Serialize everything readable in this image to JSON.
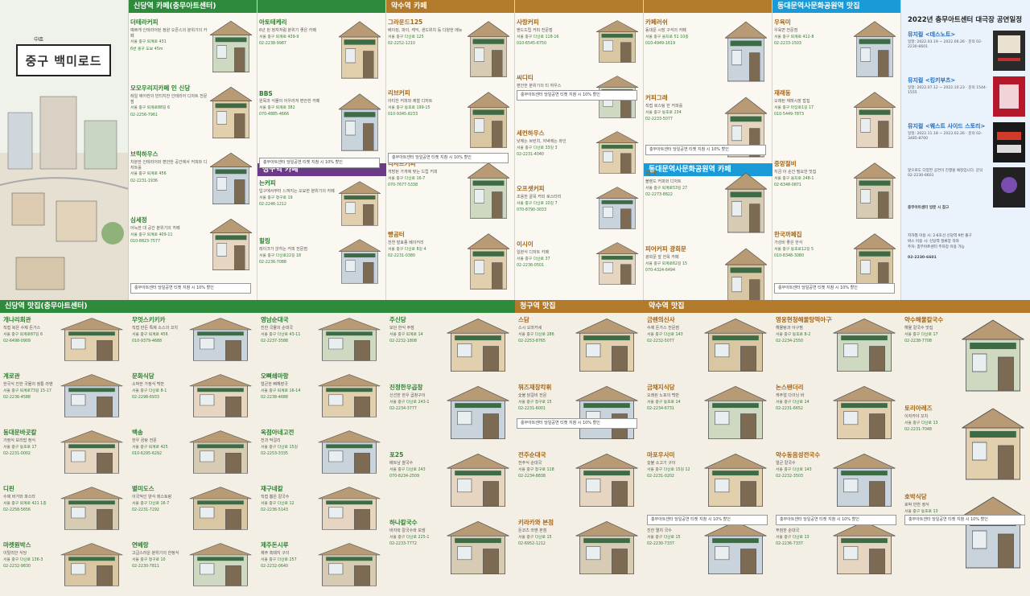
{
  "cover": {
    "hanja": "中區",
    "title": "중구 백미로드"
  },
  "sections_top": {
    "sindang": "신당역 카페(충무아트센터)",
    "yaksu": "약수역 카페",
    "cheonggu": "청구역 카페",
    "ddp": "동대문역사문화공원역 맛집",
    "ddp_cafe": "동대문역사문화공원역 카페"
  },
  "sections_bottom": {
    "sindang": "신당역 맛집(충무아트센터)",
    "cheonggu": "청구역 맛집",
    "yaksu": "약수역 맛집"
  },
  "cafes_sindang": [
    {
      "name": "더테라커피",
      "desc": "예쁘게 인테리어된 정원 오픈스의 분위기의 카페",
      "addr": "서울 중구 퇴계로 431",
      "sub": "6번 출구 도보 45m"
    },
    {
      "name": "모모우리지카페 인 신당",
      "desc": "레일 에어컨의 빈티지한 인테리어 디저트 전문점",
      "addr": "서울 중구 퇴계로88길 6",
      "sub": "02-2256-7961"
    },
    {
      "name": "브릭하우스",
      "desc": "차분한 인테리어와 편안한 공간에서 커피와 디저트를",
      "addr": "서울 중구 퇴계로 456",
      "sub": "02-2231-1936"
    },
    {
      "name": "심세정",
      "desc": "아늑한 대 공간 분위기의 카페",
      "addr": "서울 중구 퇴계로 409-11",
      "sub": "010-8823-7577"
    }
  ],
  "cafes_sindang2": [
    {
      "name": "아토테케리",
      "desc": "6년 된 정자처럼 분위기 좋은 카페",
      "addr": "서울 중구 퇴계로 439-9",
      "sub": "02-2238-9987"
    },
    {
      "name": "BBS",
      "desc": "원목과 식물이 어우러져 편안한 카페",
      "addr": "서울 중구 퇴계로 382",
      "sub": "070-4885-4666"
    }
  ],
  "cafes_cheonggu": [
    {
      "name": "는커피",
      "desc": "입구에서부터 느껴지는 오묘한 분위기의 카페",
      "addr": "서울 중구 청구로 19",
      "sub": "02-2246-1212"
    },
    {
      "name": "힐링",
      "desc": "레이크가 앉히는 커피 전문점",
      "addr": "서울 중구 다산로22길 18",
      "sub": "02-2236-7088"
    }
  ],
  "cafes_yaksu": [
    {
      "name": "그라운드125",
      "desc": "베이킹, 파이, 케익, 샌드위치 등 다양한 메뉴",
      "addr": "서울 중구 다산로 125",
      "sub": "02-2252-1210"
    },
    {
      "name": "리브커피",
      "desc": "아티잔 커피와 제철 디저트",
      "addr": "서울 중구 동호로 199-15",
      "sub": "010-9345-8233"
    },
    {
      "name": "리사르커피",
      "desc": "개방된 가게에 맞는 드립 커피",
      "addr": "서울 중구 다산로 16-7",
      "sub": "070-7677-5338"
    },
    {
      "name": "빵공터",
      "desc": "천연 발효종 베이커리",
      "addr": "서울 중구 다산로 8길 4",
      "sub": "02-2231-0380"
    }
  ],
  "cafes_yaksu2": [
    {
      "name": "사랑커피",
      "desc": "핸드드립 커피 전문점",
      "addr": "서울 중구 다산로 118-16",
      "sub": "010-6545-6750"
    },
    {
      "name": "씨디티",
      "desc": "편안한 분위기의 티 하우스",
      "addr": "서울 중구 동호로 8길 23",
      "sub": "010-4076-2301"
    },
    {
      "name": "세컨하우스",
      "desc": "낮에는 브런치, 저녁에는 와인",
      "addr": "서울 중구 다산로 33길 3",
      "sub": "02-2231-4040"
    },
    {
      "name": "오프셋커피",
      "desc": "조용한 골목 커피 로스터리",
      "addr": "서울 중구 다산로 10길 7",
      "sub": "070-8790-3033"
    },
    {
      "name": "이시이",
      "desc": "일본식 디저트 카페",
      "addr": "서울 중구 다산로 37",
      "sub": "02-2236-0501"
    }
  ],
  "cafes_ddp": [
    {
      "name": "카페러쉬",
      "desc": "동대문 시장 구석의 카페",
      "addr": "서울 중구 을지로 51 10층",
      "sub": "010-4949-1619"
    },
    {
      "name": "커피그래",
      "desc": "직접 로스팅 한 커피를",
      "addr": "서울 중구 동호로 234",
      "sub": "02-2233-5077"
    },
    {
      "name": "피크",
      "desc": "블렌드 커피와 디저트",
      "addr": "서울 중구 퇴계로53길 27",
      "sub": "02-2273-8822"
    },
    {
      "name": "피어커피 광희문",
      "desc": "광희문 앞 한옥 카페",
      "addr": "서울 중구 퇴계로62길 15",
      "sub": "070-4324-6494"
    }
  ],
  "restaurants_ddp": [
    {
      "name": "우육미",
      "desc": "우육면 전문점",
      "addr": "서울 중구 퇴계로 412-8",
      "sub": "02-2233-1503"
    },
    {
      "name": "재래동",
      "desc": "오래된 재래시장 밥집",
      "addr": "서울 중구 마장로1길 17",
      "sub": "010-5449-7873"
    },
    {
      "name": "중앙절비",
      "desc": "지금 이 순간 필요한 맛집",
      "addr": "서울 중구 을지로 248-1",
      "sub": "02-6348-0871"
    },
    {
      "name": "한국까페집",
      "desc": "가성비 좋은 한식",
      "addr": "서울 중구 동호로12길 5",
      "sub": "010-8348-3080"
    }
  ],
  "right_info": {
    "title": "2022년 충무아트센터 대극장 공연일정",
    "shows": [
      {
        "title": "뮤지컬 <데스노트>",
        "desc": "일정: 2022.03.19 ~ 2022.06.26 · 문의 02-2230-6601"
      },
      {
        "title": "뮤지컬 <킹키부츠>",
        "desc": "일정: 2022.07.12 ~ 2022.10.23 · 문의 1544-1555"
      },
      {
        "title": "뮤지컬 <웨스트 사이드 스토리>",
        "desc": "일정: 2022.11.18 ~ 2023.02.26 · 문의 02-3485-8700"
      }
    ],
    "upcoming": "앞으로도 다양한 공연이 진행될 예정입니다. 문의 02-2230-6601",
    "legend_title": "충무아트센터 방문 시 참고",
    "legend": [
      "지하철 이용 시: 2·6호선 신당역 9번 출구",
      "버스 이용 시: 신당역 정류장 하차",
      "주차: 충무아트센터 주차장 이용 가능"
    ],
    "phone": "02-2230-6601"
  },
  "bottom_sindang": [
    {
      "name": "개나리회관",
      "desc": "직접 복은 수제 돈가스",
      "addr": "서울 중구 퇴계로87길 6",
      "sub": "02-6498-0909"
    },
    {
      "name": "계로관",
      "desc": "한국식 진한 국물의 정통 라멘",
      "addr": "서울 중구 퇴계로73길 15-17",
      "sub": "02-2236-4588"
    },
    {
      "name": "동대문바곳칼",
      "desc": "가정식 보리밥 정식",
      "addr": "서울 중구 동호로 17",
      "sub": "02-2231-0002"
    },
    {
      "name": "디핀",
      "desc": "수제 버거와 파스타",
      "addr": "서울 중구 퇴계로 421 1층",
      "sub": "02-2258-5656"
    },
    {
      "name": "마켓원박스",
      "desc": "이탈리안 식당",
      "addr": "서울 중구 다산로 136-3",
      "sub": "02-2232-9830"
    }
  ],
  "bottom_sindang2": [
    {
      "name": "무엇스키키카",
      "desc": "직접 만든 특제 소스의 꼬치",
      "addr": "서울 중구 퇴계로 456",
      "sub": "010-9379-4688"
    },
    {
      "name": "문화식당",
      "desc": "소박한 가정식 백반",
      "addr": "서울 중구 다산로 8-1",
      "sub": "02-2298-6933"
    },
    {
      "name": "백송",
      "desc": "한우 곰탕 전문",
      "addr": "서울 중구 퇴계로 425",
      "sub": "010-6295-6292"
    },
    {
      "name": "별미도스",
      "desc": "이국적인 양식 레스토랑",
      "addr": "서울 중구 다산로 16-7",
      "sub": "02-2231-7292"
    },
    {
      "name": "연베랑",
      "desc": "고급스러운 분위기의 한정식",
      "addr": "서울 중구 청구로 10",
      "sub": "02-2230-7811"
    }
  ],
  "bottom_cheong": [
    {
      "name": "영남순대국",
      "desc": "진한 국물의 순대국",
      "addr": "서울 중구 다산로 43-11",
      "sub": "02-2237-3588"
    },
    {
      "name": "오뼈쇄마항",
      "desc": "얼큰한 뼈해장국",
      "addr": "서울 중구 퇴계로 16-14",
      "sub": "02-2238-4688"
    },
    {
      "name": "옥점아네고전",
      "desc": "전과 막걸리",
      "addr": "서울 중구 다산로 15길",
      "sub": "02-2253-3335"
    },
    {
      "name": "재구네칼",
      "desc": "직접 뽑은 칼국수",
      "addr": "서울 중구 다산로 12",
      "sub": "02-2236-5143"
    },
    {
      "name": "제주돈시루",
      "desc": "제주 흑돼지 구이",
      "addr": "서울 중구 다산로 257",
      "sub": "02-2232-0640"
    }
  ],
  "bottom_cheong2": [
    {
      "name": "주신당",
      "desc": "모던 한식 주점",
      "addr": "서울 중구 퇴계로 14",
      "sub": "02-2232-1808"
    },
    {
      "name": "진정한우곱창",
      "desc": "신선한 한우 곱창구이",
      "addr": "서울 중구 다산로 243-1",
      "sub": "02-2234-3777"
    },
    {
      "name": "포25",
      "desc": "베트남 쌀국수",
      "addr": "서울 중구 다산로 243",
      "sub": "070-8234-2509"
    },
    {
      "name": "하나칼국수",
      "desc": "바지락 칼국수와 보쌈",
      "addr": "서울 중구 다산로 225-1",
      "sub": "02-2233-7772"
    }
  ],
  "bottom_cg_food": [
    {
      "name": "스담",
      "desc": "스시 오마카세",
      "addr": "서울 중구 다산로 286",
      "sub": "02-2253-8765"
    },
    {
      "name": "뭐즈재장칵휘",
      "desc": "숯불 닭갈비 전문",
      "addr": "서울 중구 청구로 15",
      "sub": "02-2231-6001"
    },
    {
      "name": "전주순대국",
      "desc": "전주식 순대국",
      "addr": "서울 중구 청구로 118",
      "sub": "02-2234-8838"
    },
    {
      "name": "키라카와 본점",
      "desc": "돈코츠 라멘 본점",
      "addr": "서울 중구 다산로 15",
      "sub": "02-6952-1212"
    }
  ],
  "bottom_yaksu": [
    {
      "name": "금렌의신사",
      "desc": "수제 돈가스 전문점",
      "addr": "서울 중구 다산로 143",
      "sub": "02-2232-5077"
    },
    {
      "name": "금채지식당",
      "desc": "오래된 노포의 백반",
      "addr": "서울 중구 동호로 14",
      "sub": "02-2234-6731"
    },
    {
      "name": "마포우사미",
      "desc": "숯불 소고기 구이",
      "addr": "서울 중구 다산로 15길 12",
      "sub": "02-2231-0202"
    },
    {
      "name": "만호자국수",
      "desc": "진한 멸치 국수",
      "addr": "서울 중구 다산로 15",
      "sub": "02-2230-7337"
    }
  ],
  "bottom_yaksu2": [
    {
      "name": "영웅현청해물탕떡아구찜",
      "desc": "해물탕과 아구찜",
      "addr": "서울 중구 동호로 8-2",
      "sub": "02-2234-2550"
    },
    {
      "name": "논스탠더리",
      "desc": "캐주얼 다이닝 바",
      "addr": "서울 중구 다산로 14",
      "sub": "02-2231-6652"
    },
    {
      "name": "약수동음성전국수",
      "desc": "얼큰 칼국수",
      "addr": "서울 중구 다산로 143",
      "sub": "02-2232-3503"
    },
    {
      "name": "약수순대국",
      "desc": "푸짐한 순대국",
      "addr": "서울 중구 다산로 13",
      "sub": "02-2236-7337"
    }
  ],
  "bottom_yaksu3": [
    {
      "name": "약수해물칼국수",
      "desc": "해물 칼국수 맛집",
      "addr": "서울 중구 다산로 17",
      "sub": "02-2238-7708"
    },
    {
      "name": "토리아레즈",
      "desc": "이자카야 꼬치",
      "addr": "서울 중구 다산로 13",
      "sub": "02-2231-7048"
    },
    {
      "name": "호박식당",
      "desc": "호박 반찬 정식",
      "addr": "서울 중구 동호로 13",
      "sub": "02-2238-5545"
    }
  ],
  "note_discount": "충무아트센터 당일공연 티켓 지참 시 10% 할인"
}
